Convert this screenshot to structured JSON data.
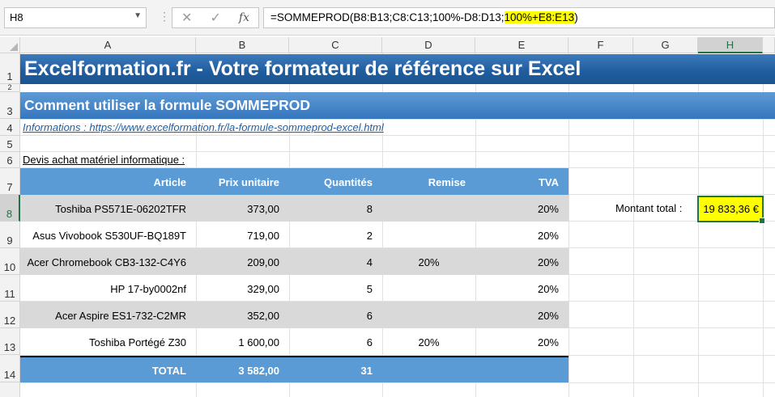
{
  "formula_bar": {
    "name_box": "H8",
    "cancel_icon": "✕",
    "enter_icon": "✓",
    "fx_label": "fx",
    "formula_prefix": "=SOMMEPROD(B8:B13;C8:C13;100%-D8:D13;",
    "formula_highlight": "100%+E8:E13",
    "formula_suffix": ")"
  },
  "columns": [
    "A",
    "B",
    "C",
    "D",
    "E",
    "F",
    "G",
    "H"
  ],
  "rows": [
    "1",
    "2",
    "3",
    "4",
    "5",
    "6",
    "7",
    "8",
    "9",
    "10",
    "11",
    "12",
    "13",
    "14"
  ],
  "selected_cell": {
    "column": "H",
    "row": "8"
  },
  "sheet": {
    "title": "Excelformation.fr - Votre formateur de référence sur Excel",
    "subtitle": "Comment utiliser la formule SOMMEPROD",
    "info_link": "Informations : https://www.excelformation.fr/la-formule-sommeprod-excel.html",
    "devis_label": "Devis achat matériel informatique :"
  },
  "table": {
    "headers": [
      "Article",
      "Prix unitaire",
      "Quantités",
      "Remise",
      "TVA"
    ],
    "rows": [
      {
        "article": "Toshiba PS571E-06202TFR",
        "prix": "373,00",
        "quantite": "8",
        "remise": "",
        "tva": "20%"
      },
      {
        "article": "Asus Vivobook S530UF-BQ189T",
        "prix": "719,00",
        "quantite": "2",
        "remise": "",
        "tva": "20%"
      },
      {
        "article": "Acer Chromebook CB3-132-C4Y6",
        "prix": "209,00",
        "quantite": "4",
        "remise": "20%",
        "tva": "20%"
      },
      {
        "article": "HP 17-by0002nf",
        "prix": "329,00",
        "quantite": "5",
        "remise": "",
        "tva": "20%"
      },
      {
        "article": "Acer Aspire ES1-732-C2MR",
        "prix": "352,00",
        "quantite": "6",
        "remise": "",
        "tva": "20%"
      },
      {
        "article": "Toshiba Portégé Z30",
        "prix": "1 600,00",
        "quantite": "6",
        "remise": "20%",
        "tva": "20%"
      }
    ],
    "total": {
      "label": "TOTAL",
      "prix": "3 582,00",
      "quantite": "31"
    }
  },
  "montant": {
    "label": "Montant total :",
    "value": "19 833,36 €"
  },
  "colors": {
    "banner_dark": "#1f5c9e",
    "banner_light": "#4a89ca",
    "table_header": "#5b9bd5",
    "row_gray": "#d9d9d9",
    "highlight": "#ffff00",
    "selection": "#217346"
  }
}
